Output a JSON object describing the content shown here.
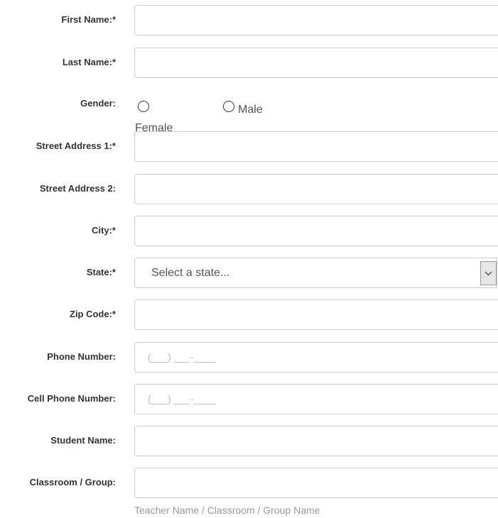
{
  "fields": {
    "first_name": {
      "label": "First Name:*",
      "value": "",
      "placeholder": ""
    },
    "last_name": {
      "label": "Last Name:*",
      "value": "",
      "placeholder": ""
    },
    "gender": {
      "label": "Gender:",
      "options": [
        "Female",
        "Male"
      ],
      "selected": ""
    },
    "street_address_1": {
      "label": "Street Address 1:*",
      "value": "",
      "placeholder": ""
    },
    "street_address_2": {
      "label": "Street Address 2:",
      "value": "",
      "placeholder": ""
    },
    "city": {
      "label": "City:*",
      "value": "",
      "placeholder": ""
    },
    "state": {
      "label": "State:*",
      "selected": "Select a state..."
    },
    "zip_code": {
      "label": "Zip Code:*",
      "value": "",
      "placeholder": ""
    },
    "phone_number": {
      "label": "Phone Number:",
      "value": "",
      "placeholder": "(___) ___-____"
    },
    "cell_phone_number": {
      "label": "Cell Phone Number:",
      "value": "",
      "placeholder": "(___) ___-____"
    },
    "student_name": {
      "label": "Student Name:",
      "value": "",
      "placeholder": ""
    },
    "classroom_group": {
      "label": "Classroom / Group:",
      "value": "",
      "placeholder": "",
      "help": "Teacher Name / Classroom / Group Name"
    }
  },
  "icons": {
    "select_arrow": "chevron-down-icon"
  }
}
